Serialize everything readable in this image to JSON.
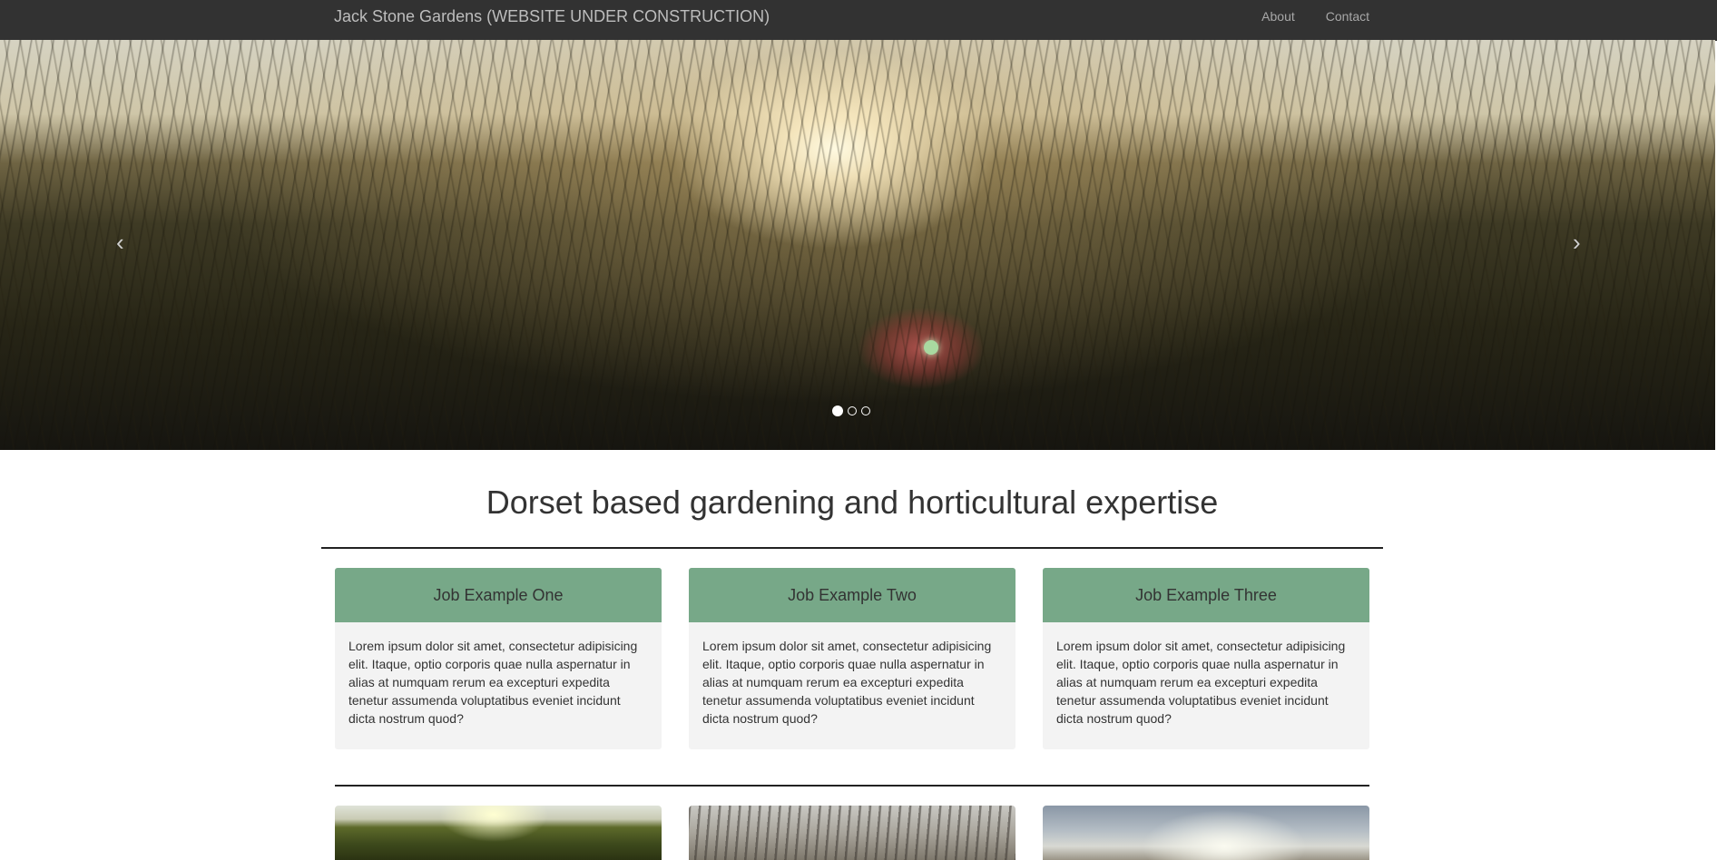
{
  "navbar": {
    "brand": "Jack Stone Gardens (WEBSITE UNDER CONSTRUCTION)",
    "links": [
      {
        "label": "About"
      },
      {
        "label": "Contact"
      }
    ]
  },
  "carousel": {
    "prev_glyph": "‹",
    "next_glyph": "›",
    "slide_count": 3,
    "active_slide": 1
  },
  "main": {
    "headline": "Dorset based gardening and horticultural expertise",
    "cards": [
      {
        "title": "Job Example One",
        "body": "Lorem ipsum dolor sit amet, consectetur adipisicing elit. Itaque, optio corporis quae nulla aspernatur in alias at numquam rerum ea excepturi expedita tenetur assumenda voluptatibus eveniet incidunt dicta nostrum quod?"
      },
      {
        "title": "Job Example Two",
        "body": "Lorem ipsum dolor sit amet, consectetur adipisicing elit. Itaque, optio corporis quae nulla aspernatur in alias at numquam rerum ea excepturi expedita tenetur assumenda voluptatibus eveniet incidunt dicta nostrum quod?"
      },
      {
        "title": "Job Example Three",
        "body": "Lorem ipsum dolor sit amet, consectetur adipisicing elit. Itaque, optio corporis quae nulla aspernatur in alias at numquam rerum ea excepturi expedita tenetur assumenda voluptatibus eveniet incidunt dicta nostrum quod?"
      }
    ]
  },
  "colors": {
    "navbar_bg": "#323232",
    "card_header": "#77a888",
    "card_body": "#f3f3f3"
  }
}
